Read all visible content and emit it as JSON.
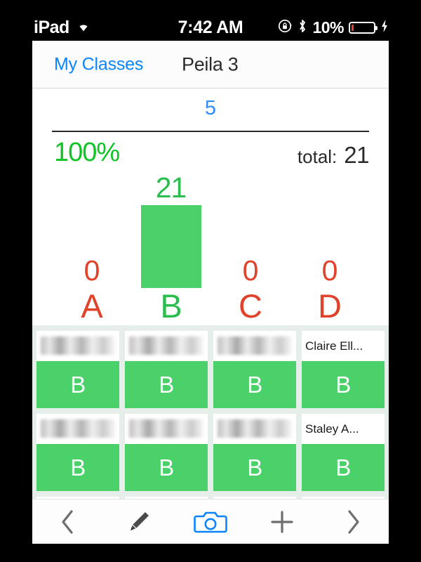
{
  "status_bar": {
    "device_name": "iPad",
    "wifi_icon": "wifi-icon",
    "time": "7:42 AM",
    "rotation_lock_icon": "rotation-lock-icon",
    "bluetooth_icon": "bluetooth-icon",
    "battery_percent": "10%",
    "battery_fill_pct": 10,
    "charging_icon": "lightning-bolt-icon",
    "battery_color": "#e8422c"
  },
  "nav": {
    "back_label": "My Classes",
    "title": "Peila 3"
  },
  "summary": {
    "question_number": "5",
    "question_number_color": "#2f8bf7",
    "percent_correct": "100%",
    "percent_color": "#10c425",
    "total_label": "total:",
    "total_value": "21"
  },
  "chart_data": {
    "type": "bar",
    "title": "",
    "xlabel": "",
    "ylabel": "",
    "categories": [
      "A",
      "B",
      "C",
      "D"
    ],
    "values": [
      0,
      21,
      0,
      0
    ],
    "ylim": [
      0,
      21
    ],
    "grid": false,
    "legend": "none",
    "correct_answer": "B",
    "total_responses": 21,
    "percent_correct": 100,
    "bar_colors": [
      "#e0422a",
      "#4ad16a",
      "#e0422a",
      "#e0422a"
    ],
    "label_colors": [
      "#e0422a",
      "#2bbd4e",
      "#e0422a",
      "#e0422a"
    ]
  },
  "students": {
    "answer_color": "#4ad16a",
    "cards": [
      {
        "name": "",
        "redacted": true,
        "answer": "B"
      },
      {
        "name": "",
        "redacted": true,
        "answer": "B"
      },
      {
        "name": "",
        "redacted": true,
        "answer": "B"
      },
      {
        "name": "Claire Ell...",
        "redacted": false,
        "answer": "B"
      },
      {
        "name": "",
        "redacted": true,
        "answer": "B"
      },
      {
        "name": "",
        "redacted": true,
        "answer": "B"
      },
      {
        "name": "",
        "redacted": true,
        "answer": "B"
      },
      {
        "name": "Staley A...",
        "redacted": false,
        "answer": "B"
      }
    ]
  },
  "toolbar": {
    "items": [
      {
        "icon": "chevron-left-icon",
        "name": "previous-question-button"
      },
      {
        "icon": "pencil-icon",
        "name": "edit-button"
      },
      {
        "icon": "camera-icon",
        "name": "scan-button"
      },
      {
        "icon": "plus-icon",
        "name": "add-button"
      },
      {
        "icon": "chevron-right-icon",
        "name": "next-question-button"
      }
    ],
    "accent_color": "#0a84ff",
    "inactive_color": "#6e6e6e"
  }
}
